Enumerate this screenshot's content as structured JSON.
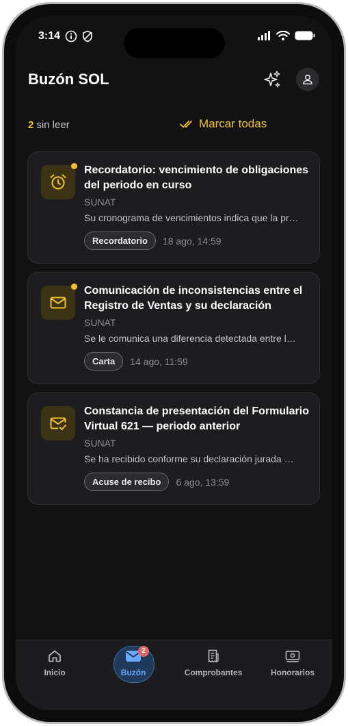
{
  "status_bar": {
    "time": "3:14"
  },
  "header": {
    "title": "Buzón SOL"
  },
  "summary": {
    "unread_count": "2",
    "unread_label": "sin leer",
    "mark_all_label": "Marcar todas"
  },
  "messages": [
    {
      "title": "Recordatorio: vencimiento de obligaciones del periodo en curso",
      "sender": "SUNAT",
      "preview": "Su cronograma de vencimientos indica que la pr…",
      "tag": "Recordatorio",
      "date": "18 ago, 14:59",
      "unread": true,
      "icon": "alarm-clock-icon"
    },
    {
      "title": "Comunicación de inconsistencias entre el Registro de Ventas y su declaración",
      "sender": "SUNAT",
      "preview": "Se le comunica una diferencia detectada entre l…",
      "tag": "Carta",
      "date": "14 ago, 11:59",
      "unread": true,
      "icon": "envelope-icon"
    },
    {
      "title": "Constancia de presentación del Formulario Virtual 621 — periodo anterior",
      "sender": "SUNAT",
      "preview": "Se ha recibido conforme su declaración jurada …",
      "tag": "Acuse de recibo",
      "date": "6 ago, 13:59",
      "unread": false,
      "icon": "envelope-check-icon"
    }
  ],
  "bottom_nav": {
    "items": [
      {
        "label": "Inicio",
        "icon": "home-icon"
      },
      {
        "label": "Buzón",
        "icon": "mail-icon",
        "badge": "2",
        "active": true
      },
      {
        "label": "Comprobantes",
        "icon": "receipt-icon"
      },
      {
        "label": "Honorarios",
        "icon": "cash-icon"
      }
    ]
  },
  "colors": {
    "accent": "#f2c12e",
    "active_nav": "#6aa7ff",
    "background": "#121212",
    "card": "#1d1d1f",
    "badge": "#e06767"
  }
}
